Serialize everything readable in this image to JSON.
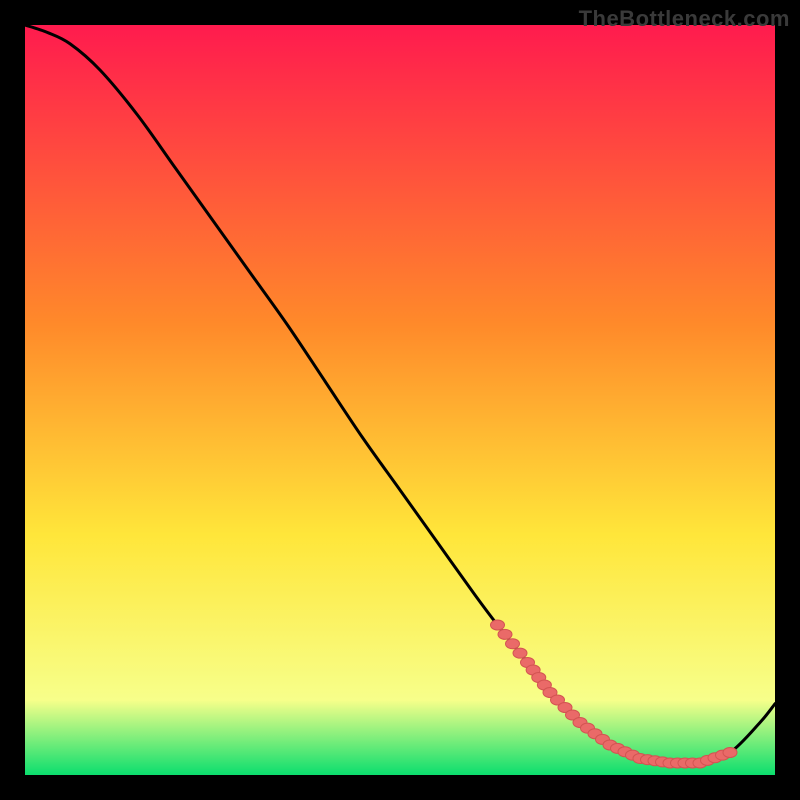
{
  "watermark": "TheBottleneck.com",
  "colors": {
    "bg": "#000000",
    "grad_top": "#ff1b4e",
    "grad_mid1": "#ff8a2a",
    "grad_mid2": "#ffe63a",
    "grad_low": "#f7ff8a",
    "grad_bottom": "#0bde6e",
    "curve": "#000000",
    "marker_fill": "#ea6a68",
    "marker_stroke": "#d35452"
  },
  "chart_data": {
    "type": "line",
    "title": "",
    "xlabel": "",
    "ylabel": "",
    "xlim": [
      0,
      100
    ],
    "ylim": [
      0,
      100
    ],
    "grid": false,
    "legend": false,
    "series": [
      {
        "name": "bottleneck-curve",
        "x": [
          0,
          3,
          6,
          10,
          15,
          20,
          25,
          30,
          35,
          40,
          45,
          50,
          55,
          60,
          63,
          67,
          70,
          74,
          78,
          82,
          86,
          90,
          94,
          98,
          100
        ],
        "y": [
          100,
          99,
          97.5,
          94,
          88,
          81,
          74,
          67,
          60,
          52.5,
          45,
          38,
          31,
          24,
          20,
          15,
          11,
          7,
          4,
          2.2,
          1.6,
          1.6,
          3,
          7,
          9.5
        ]
      }
    ],
    "markers": {
      "name": "bottleneck-region",
      "x": [
        63,
        67,
        70,
        74,
        78,
        82,
        86,
        90,
        94
      ],
      "y": [
        20,
        15,
        11,
        7,
        4,
        2.2,
        1.6,
        1.6,
        3
      ]
    }
  }
}
